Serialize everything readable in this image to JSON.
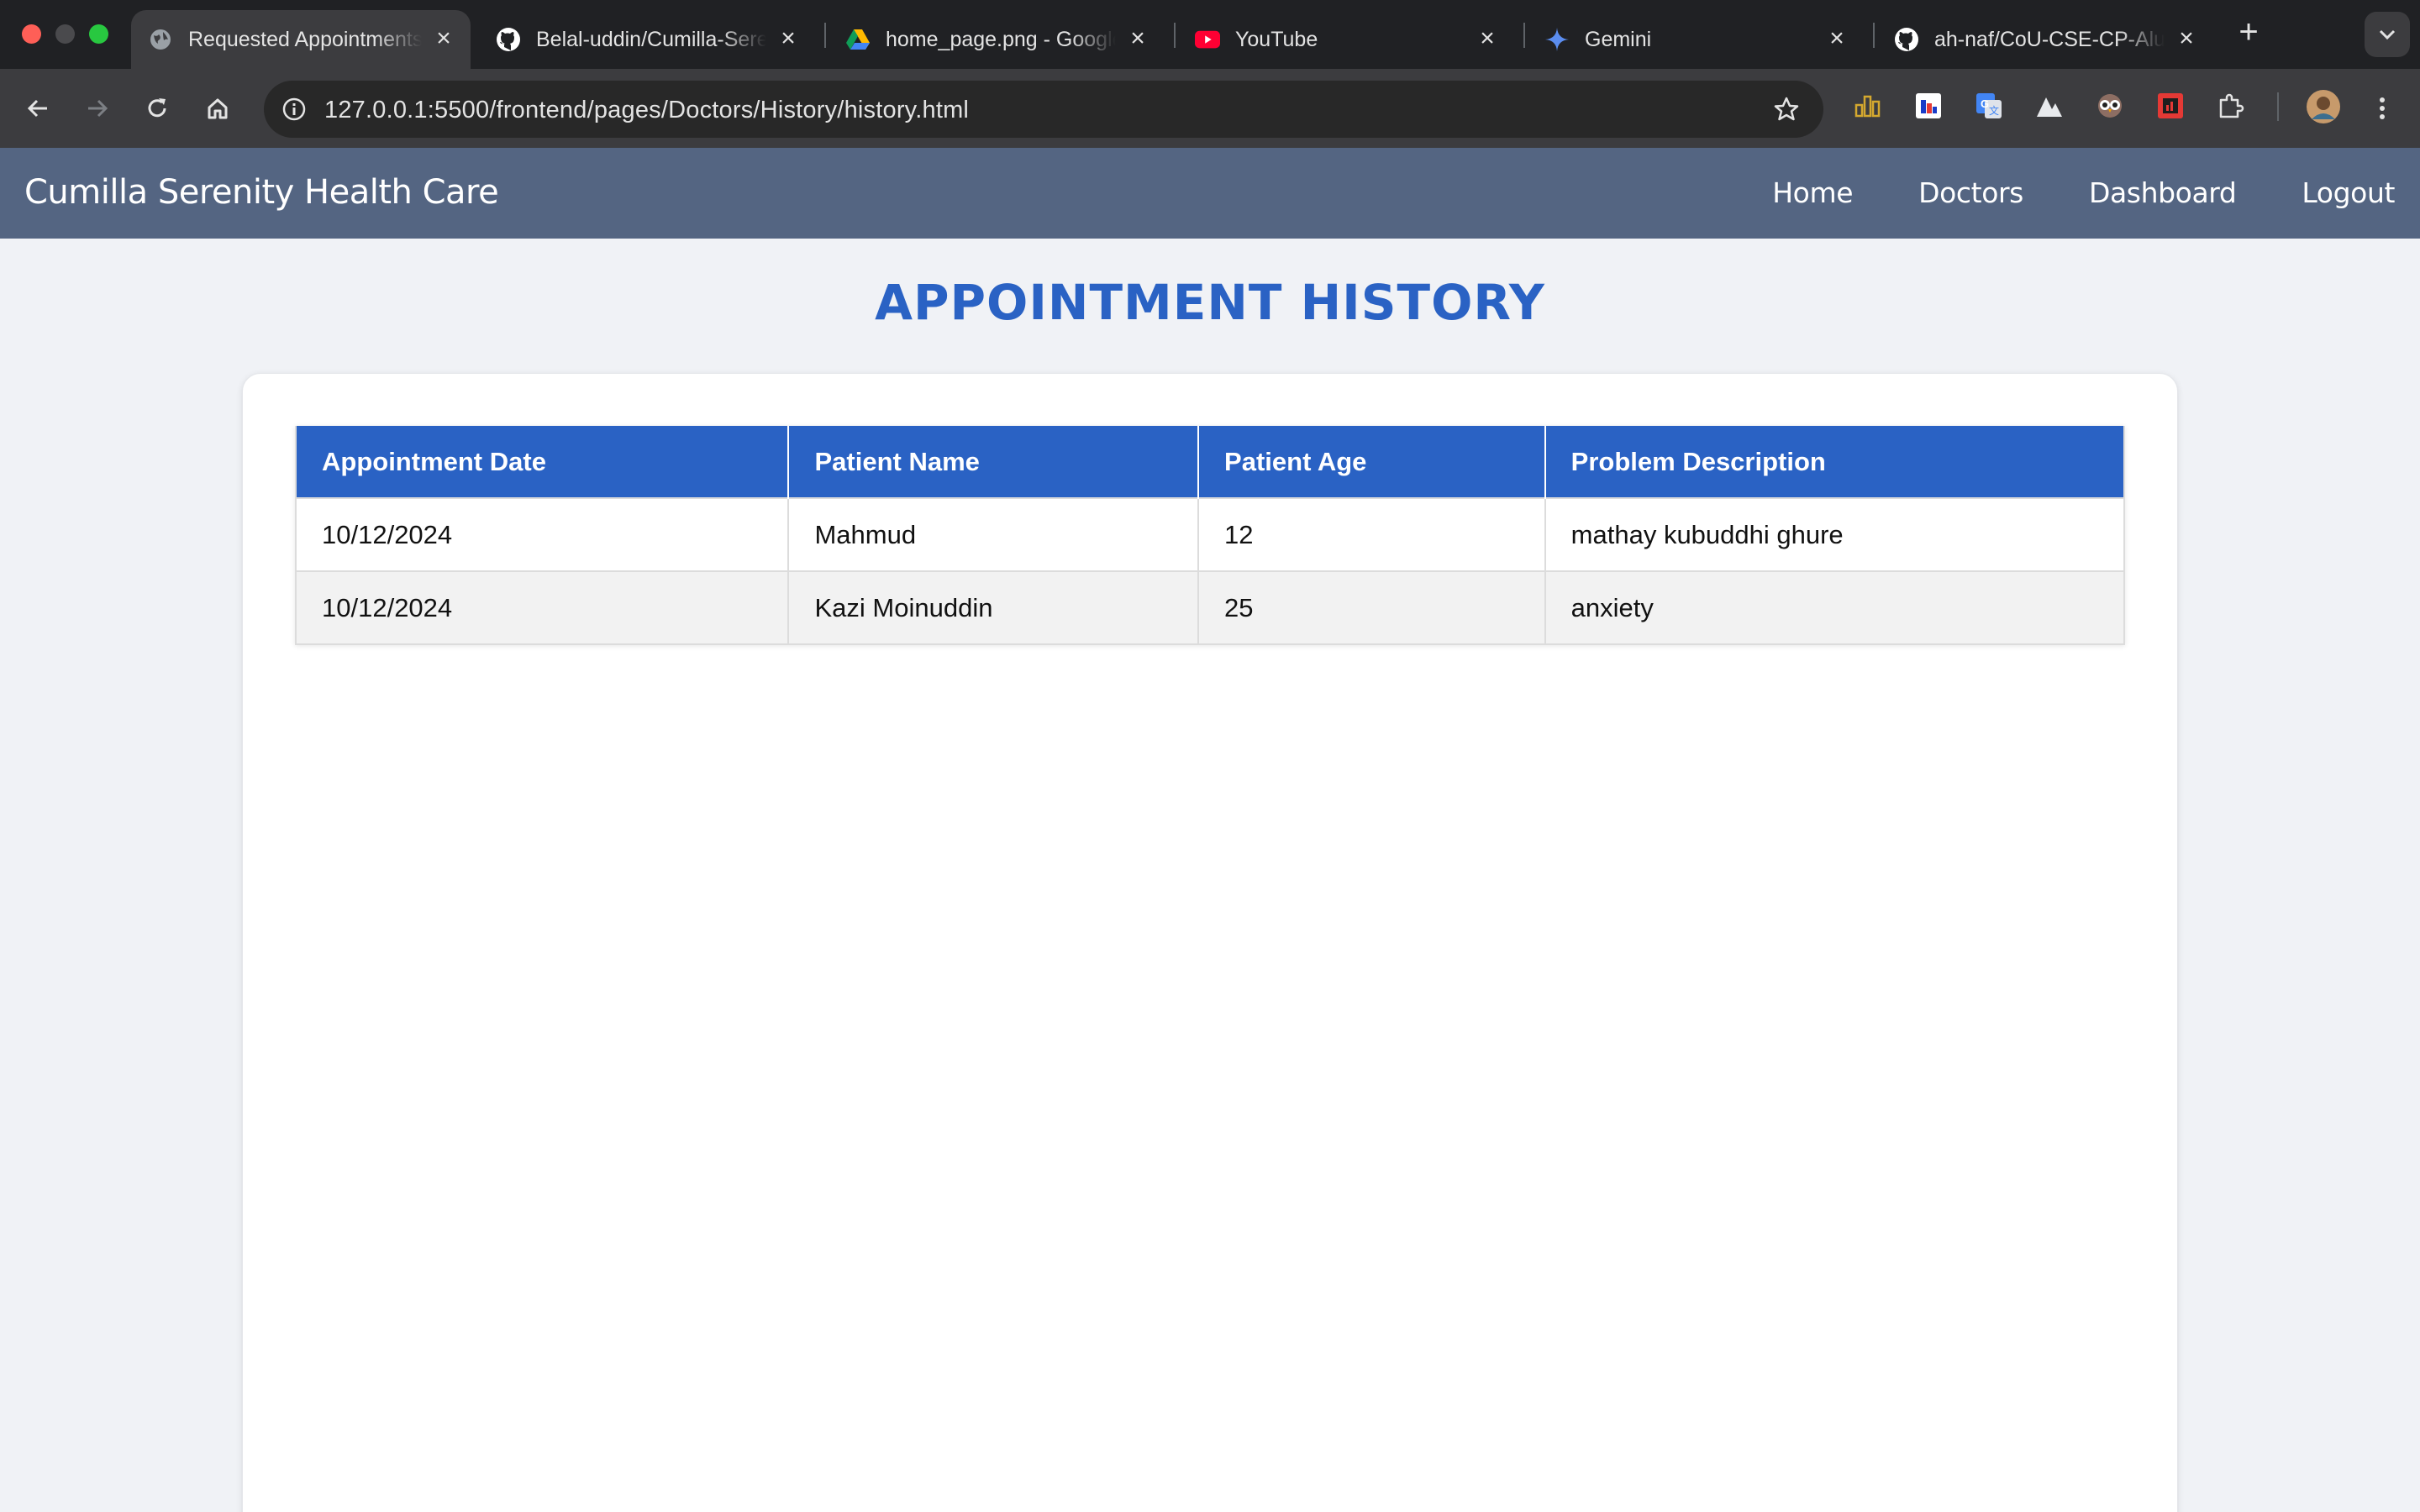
{
  "browser": {
    "tabs": [
      {
        "title": "Requested Appointments",
        "icon": "globe-icon",
        "active": true
      },
      {
        "title": "Belal-uddin/Cumilla-Serenity-Health-Care",
        "icon": "github-icon",
        "active": false
      },
      {
        "title": "home_page.png - Google Drive",
        "icon": "google-drive-icon",
        "active": false
      },
      {
        "title": "YouTube",
        "icon": "youtube-icon",
        "active": false
      },
      {
        "title": "Gemini",
        "icon": "gemini-icon",
        "active": false
      },
      {
        "title": "ah-naf/CoU-CSE-CP-Alumni",
        "icon": "github-icon",
        "active": false
      }
    ],
    "url": "127.0.0.1:5500/frontend/pages/Doctors/History/history.html"
  },
  "site": {
    "brand": "Cumilla Serenity Health Care",
    "nav": [
      "Home",
      "Doctors",
      "Dashboard",
      "Logout"
    ]
  },
  "page": {
    "heading": "APPOINTMENT HISTORY"
  },
  "table": {
    "columns": [
      "Appointment Date",
      "Patient Name",
      "Patient Age",
      "Problem Description"
    ],
    "rows": [
      [
        "10/12/2024",
        "Mahmud",
        "12",
        "mathay kubuddhi ghure"
      ],
      [
        "10/12/2024",
        "Kazi Moinuddin",
        "25",
        "anxiety"
      ]
    ]
  },
  "colors": {
    "navbar": "#546582",
    "accent": "#2a62c4",
    "page_bg": "#f0f2f6"
  }
}
